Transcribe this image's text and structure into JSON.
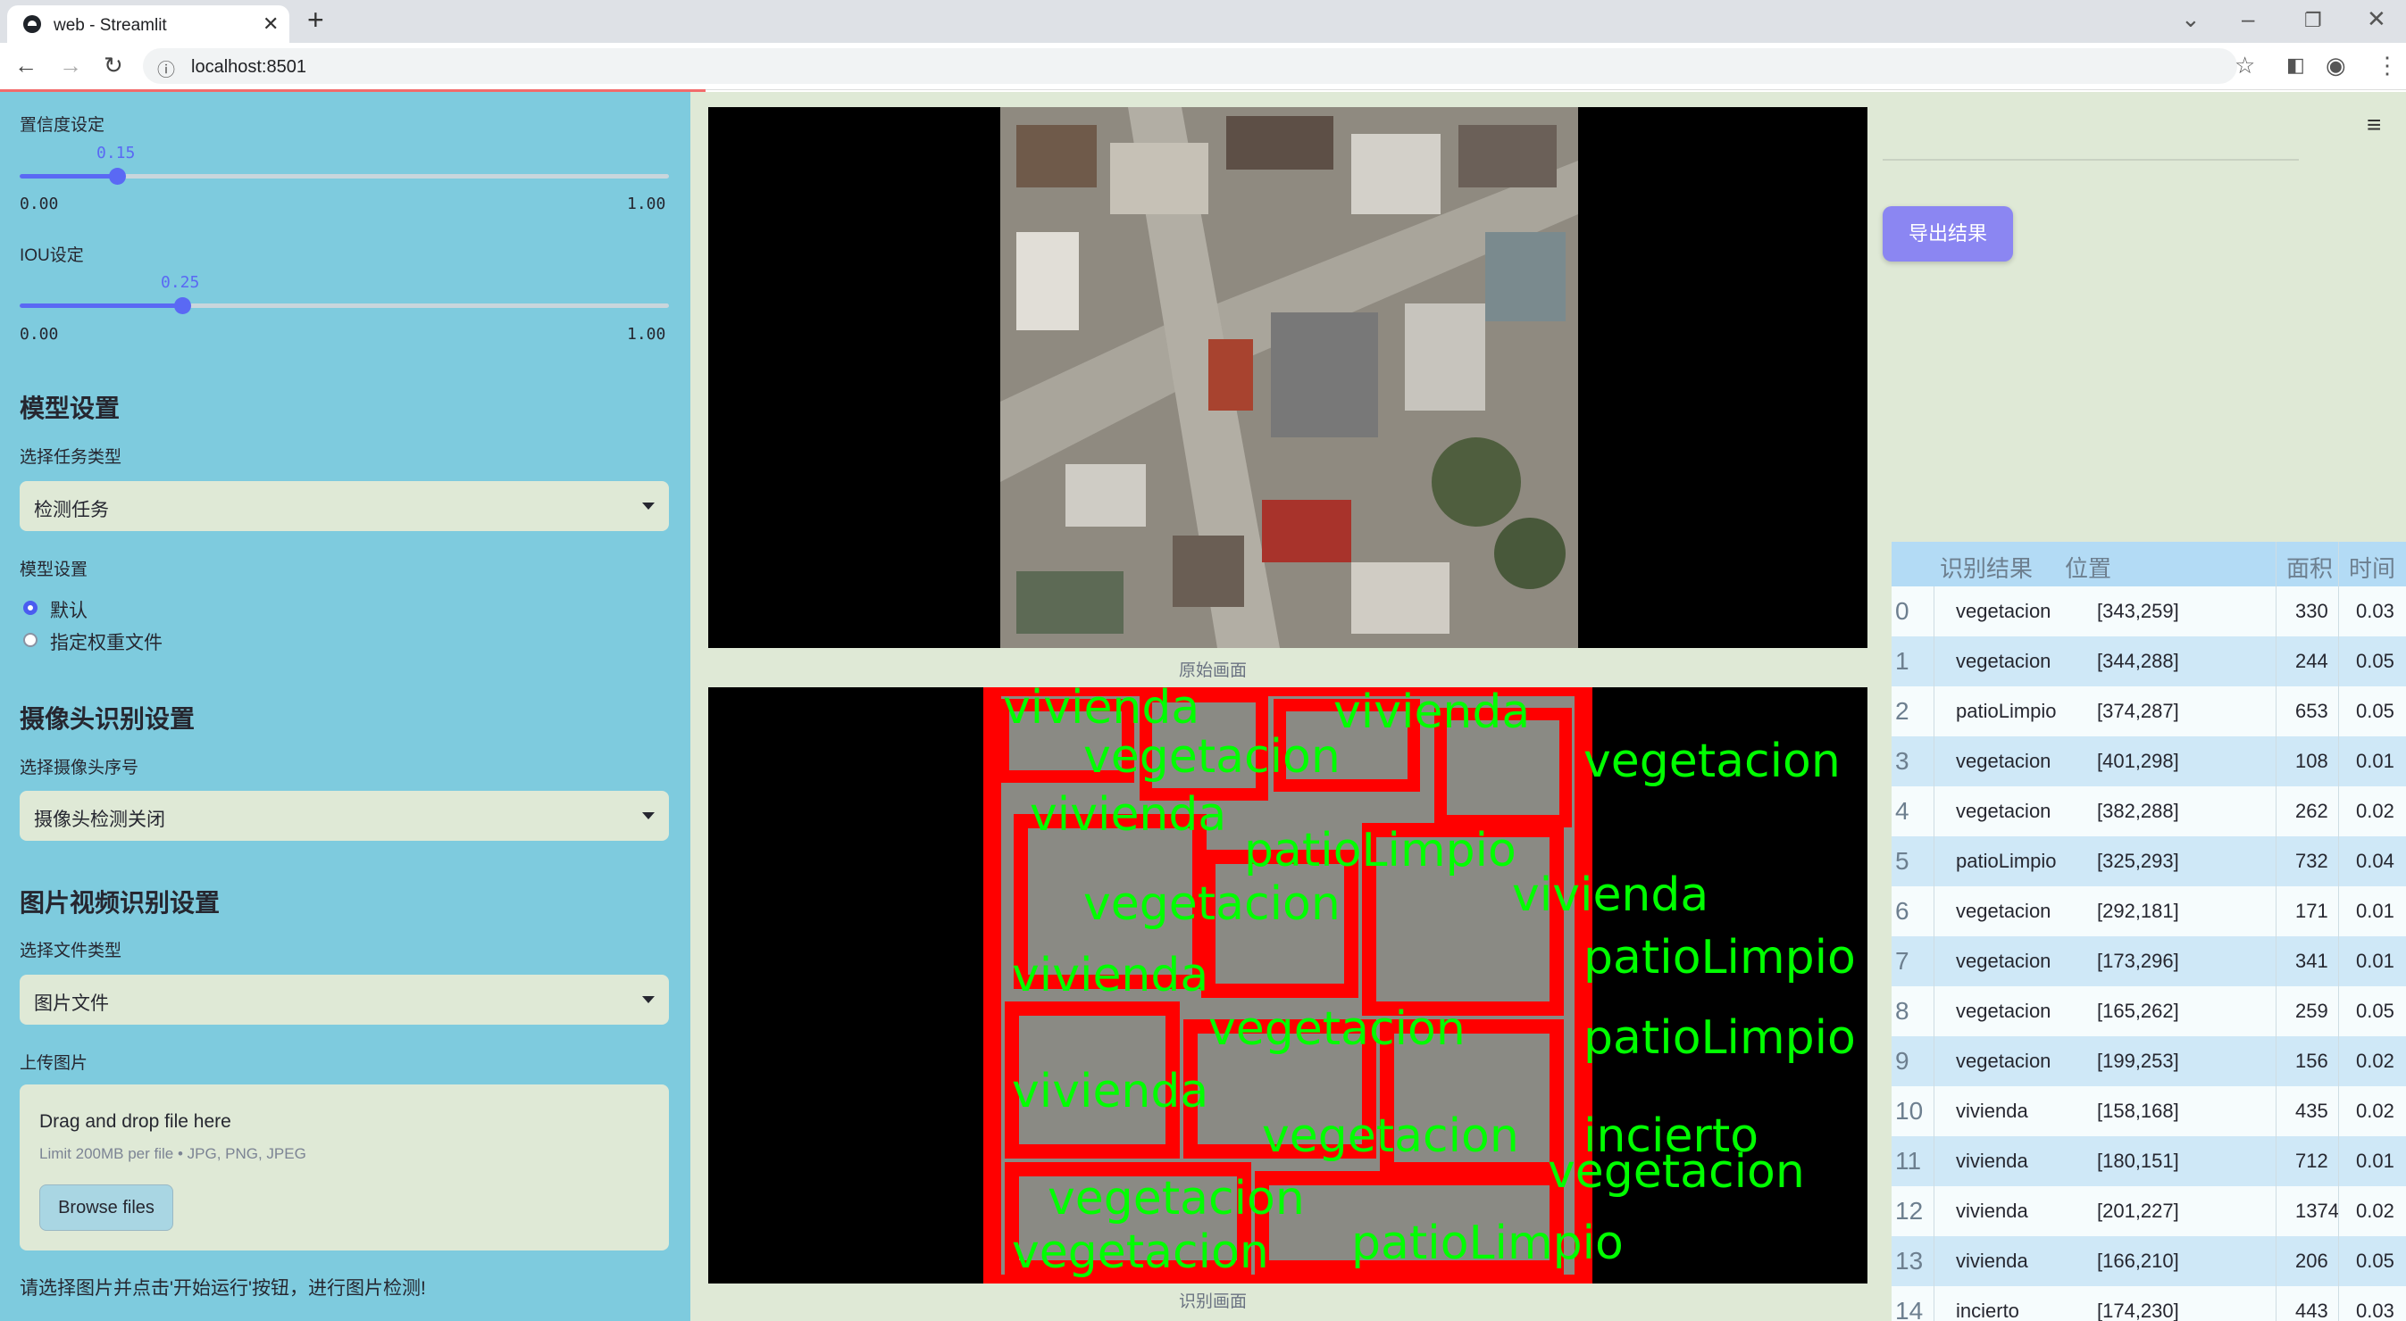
{
  "browser": {
    "tab_title": "web - Streamlit",
    "new_tab": "+",
    "url": "localhost:8501"
  },
  "sidebar": {
    "conf_label": "置信度设定",
    "conf_value": "0.15",
    "conf_fraction": 0.15,
    "conf_min": "0.00",
    "conf_max": "1.00",
    "iou_label": "IOU设定",
    "iou_value": "0.25",
    "iou_fraction": 0.25,
    "iou_min": "0.00",
    "iou_max": "1.00",
    "model_header": "模型设置",
    "task_label": "选择任务类型",
    "task_value": "检测任务",
    "model_label": "模型设置",
    "radio_default": "默认",
    "radio_custom": "指定权重文件",
    "camera_header": "摄像头识别设置",
    "camera_label": "选择摄像头序号",
    "camera_value": "摄像头检测关闭",
    "media_header": "图片视频识别设置",
    "filetype_label": "选择文件类型",
    "filetype_value": "图片文件",
    "upload_label": "上传图片",
    "upload_title": "Drag and drop file here",
    "upload_limit": "Limit 200MB per file • JPG, PNG, JPEG",
    "browse_label": "Browse files",
    "hint": "请选择图片并点击'开始运行'按钮，进行图片检测!"
  },
  "main": {
    "original_caption": "原始画面",
    "result_caption": "识别画面",
    "export_label": "导出结果"
  },
  "table": {
    "headers": [
      "识别结果",
      "位置",
      "面积",
      "时间"
    ],
    "rows": [
      {
        "i": "0",
        "label": "vegetacion",
        "pos": "[343,259]",
        "area": "330",
        "time": "0.03"
      },
      {
        "i": "1",
        "label": "vegetacion",
        "pos": "[344,288]",
        "area": "244",
        "time": "0.05"
      },
      {
        "i": "2",
        "label": "patioLimpio",
        "pos": "[374,287]",
        "area": "653",
        "time": "0.05"
      },
      {
        "i": "3",
        "label": "vegetacion",
        "pos": "[401,298]",
        "area": "108",
        "time": "0.01"
      },
      {
        "i": "4",
        "label": "vegetacion",
        "pos": "[382,288]",
        "area": "262",
        "time": "0.02"
      },
      {
        "i": "5",
        "label": "patioLimpio",
        "pos": "[325,293]",
        "area": "732",
        "time": "0.04"
      },
      {
        "i": "6",
        "label": "vegetacion",
        "pos": "[292,181]",
        "area": "171",
        "time": "0.01"
      },
      {
        "i": "7",
        "label": "vegetacion",
        "pos": "[173,296]",
        "area": "341",
        "time": "0.01"
      },
      {
        "i": "8",
        "label": "vegetacion",
        "pos": "[165,262]",
        "area": "259",
        "time": "0.05"
      },
      {
        "i": "9",
        "label": "vegetacion",
        "pos": "[199,253]",
        "area": "156",
        "time": "0.02"
      },
      {
        "i": "10",
        "label": "vivienda",
        "pos": "[158,168]",
        "area": "435",
        "time": "0.02"
      },
      {
        "i": "11",
        "label": "vivienda",
        "pos": "[180,151]",
        "area": "712",
        "time": "0.01"
      },
      {
        "i": "12",
        "label": "vivienda",
        "pos": "[201,227]",
        "area": "1374",
        "time": "0.02"
      },
      {
        "i": "13",
        "label": "vivienda",
        "pos": "[166,210]",
        "area": "206",
        "time": "0.05"
      },
      {
        "i": "14",
        "label": "incierto",
        "pos": "[174,230]",
        "area": "443",
        "time": "0.03"
      }
    ]
  },
  "overlay_labels": [
    "vivienda",
    "vegetacion",
    "patioLimpio",
    "incierto"
  ],
  "colors": {
    "sidebar_bg": "#7ecbde",
    "main_bg": "#dfe9d6",
    "accent": "#5a69f4",
    "export_btn": "#8b86f2",
    "box_red": "#ff0000",
    "label_green": "#00ff00"
  }
}
